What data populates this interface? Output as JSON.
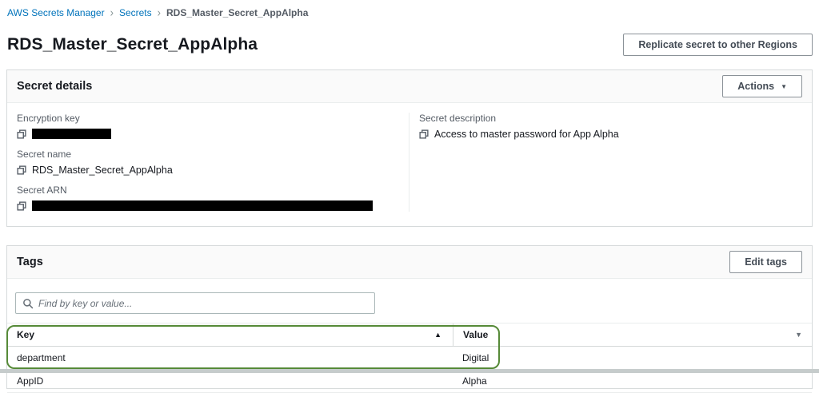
{
  "breadcrumb": {
    "separator": "›",
    "items": [
      {
        "label": "AWS Secrets Manager"
      },
      {
        "label": "Secrets"
      },
      {
        "label": "RDS_Master_Secret_AppAlpha"
      }
    ]
  },
  "header": {
    "title": "RDS_Master_Secret_AppAlpha",
    "replicate_button_label": "Replicate secret to other Regions"
  },
  "secret_details": {
    "panel_title": "Secret details",
    "actions_button_label": "Actions",
    "encryption_key_label": "Encryption key",
    "encryption_key_value": "(redacted)",
    "secret_name_label": "Secret name",
    "secret_name_value": "RDS_Master_Secret_AppAlpha",
    "secret_arn_label": "Secret ARN",
    "secret_arn_value": "(redacted)",
    "secret_description_label": "Secret description",
    "secret_description_value": "Access to master password for App Alpha"
  },
  "tags": {
    "panel_title": "Tags",
    "edit_button_label": "Edit tags",
    "search_placeholder": "Find by key or value...",
    "table": {
      "columns": [
        "Key",
        "Value"
      ],
      "rows": [
        {
          "key": "department",
          "value": "Digital"
        },
        {
          "key": "AppID",
          "value": "Alpha"
        }
      ]
    }
  },
  "icons": {
    "copy": "copy-icon",
    "search": "search-icon",
    "sort_ascending": "▲",
    "sort_descending": "▼",
    "button_caret": "▼"
  },
  "colors": {
    "link_blue": "#0073bb",
    "text_dark": "#16191f",
    "text_secondary": "#545b64",
    "panel_border": "#d6dadb",
    "divider": "#eaeded",
    "panel_header_bg": "#fafafa",
    "annotation_green": "#568a38",
    "redaction_black": "#000000"
  }
}
